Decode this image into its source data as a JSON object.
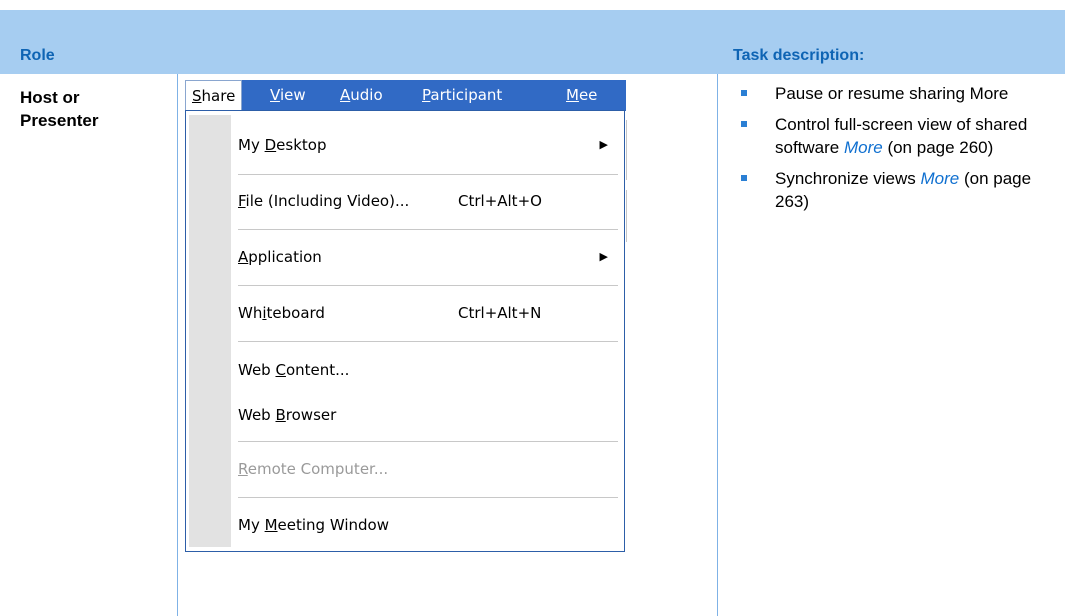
{
  "header": {
    "role_label": "Role",
    "task_label": "Task description:"
  },
  "role": {
    "line1": "Host or",
    "line2": "Presenter"
  },
  "menubar": {
    "items": [
      {
        "pre": "",
        "key": "S",
        "post": "hare"
      },
      {
        "pre": "",
        "key": "V",
        "post": "iew"
      },
      {
        "pre": "",
        "key": "A",
        "post": "udio"
      },
      {
        "pre": "",
        "key": "P",
        "post": "articipant"
      },
      {
        "pre": "",
        "key": "M",
        "post": "ee"
      }
    ]
  },
  "menu": {
    "items": [
      {
        "pre": "My ",
        "key": "D",
        "post": "esktop",
        "shortcut": "",
        "submenu": true
      },
      {
        "pre": "",
        "key": "F",
        "post": "ile (Including Video)...",
        "shortcut": "Ctrl+Alt+O"
      },
      {
        "pre": "",
        "key": "A",
        "post": "pplication",
        "shortcut": "",
        "submenu": true
      },
      {
        "pre": "Wh",
        "key": "i",
        "post": "teboard",
        "shortcut": "Ctrl+Alt+N"
      },
      {
        "pre": "Web ",
        "key": "C",
        "post": "ontent...",
        "shortcut": ""
      },
      {
        "pre": "Web ",
        "key": "B",
        "post": "rowser",
        "shortcut": ""
      },
      {
        "pre": "",
        "key": "R",
        "post": "emote Computer...",
        "shortcut": "",
        "disabled": true
      },
      {
        "pre": "My ",
        "key": "M",
        "post": "eeting Window",
        "shortcut": ""
      }
    ],
    "arrow_glyph": "▶"
  },
  "tasks": [
    {
      "text": "Pause or resume sharing More",
      "link": "",
      "after": ""
    },
    {
      "text": "Control full-screen view of shared software ",
      "link": "More",
      "after": " (on page 260)"
    },
    {
      "text": "Synchronize views ",
      "link": "More",
      "after": " (on page 263)"
    }
  ],
  "colors": {
    "header_band": "#a6cdf1",
    "header_text": "#0e64b4",
    "menubar": "#316ac5",
    "bullet": "#2a7fd4",
    "link": "#1070d0"
  }
}
